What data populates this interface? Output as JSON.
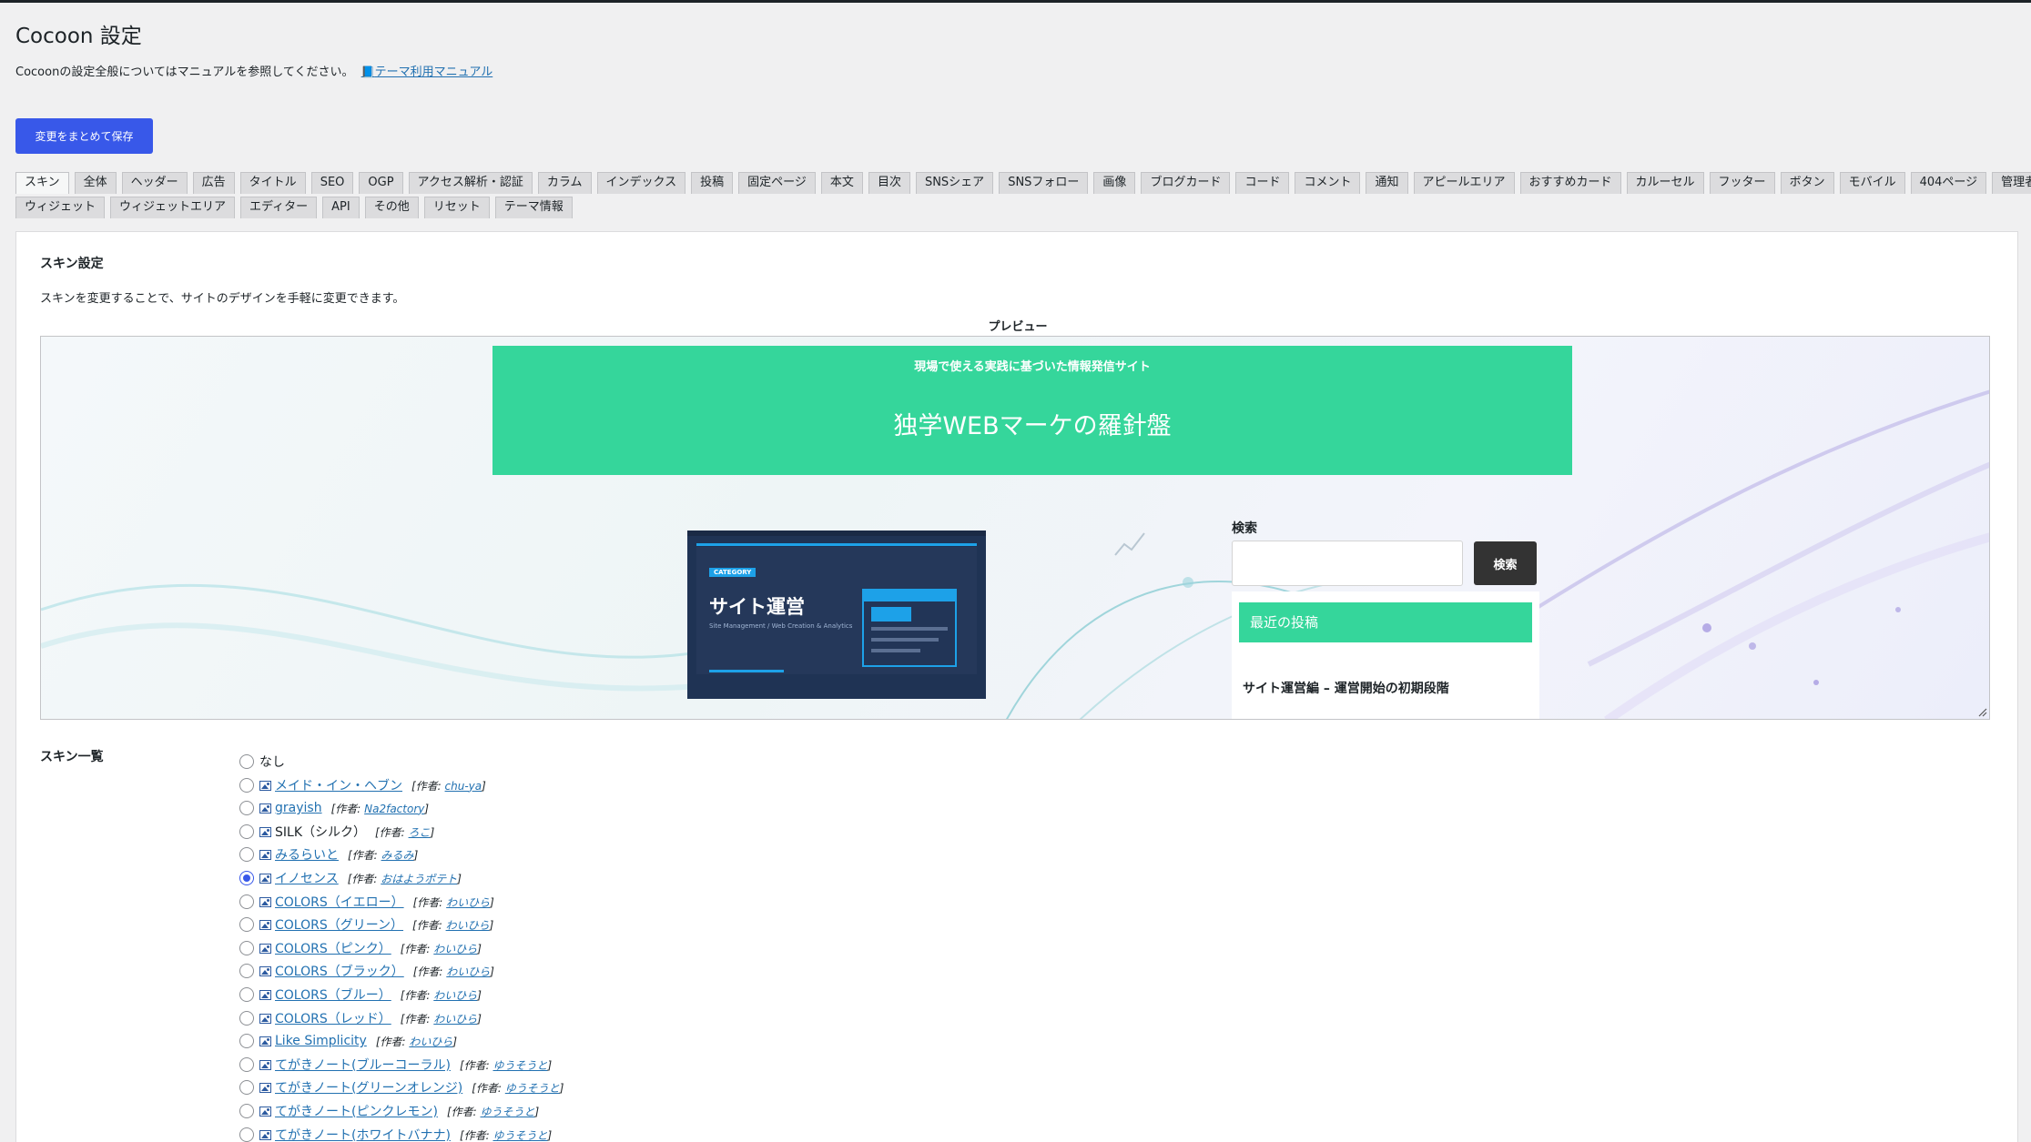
{
  "page": {
    "title": "Cocoon 設定",
    "intro": "Cocoonの設定全般についてはマニュアルを参照してください。",
    "manual_link": "テーマ利用マニュアル",
    "save_label": "変更をまとめて保存",
    "accent": "#3858e9"
  },
  "tabs_row1": [
    "スキン",
    "全体",
    "ヘッダー",
    "広告",
    "タイトル",
    "SEO",
    "OGP",
    "アクセス解析・認証",
    "カラム",
    "インデックス",
    "投稿",
    "固定ページ",
    "本文",
    "目次",
    "SNSシェア",
    "SNSフォロー",
    "画像",
    "ブログカード",
    "コード",
    "コメント",
    "通知",
    "アピールエリア",
    "おすすめカード",
    "カルーセル",
    "フッター",
    "ボタン",
    "モバイル",
    "404ページ",
    "管理者画面"
  ],
  "tabs_row2": [
    "ウィジェット",
    "ウィジェットエリア",
    "エディター",
    "API",
    "その他",
    "リセット",
    "テーマ情報"
  ],
  "skin": {
    "section_title": "スキン設定",
    "description": "スキンを変更することで、サイトのデザインを手軽に変更できます。",
    "preview_label": "プレビュー",
    "list_title": "スキン一覧"
  },
  "preview": {
    "tagline": "現場で使える実践に基づいた情報発信サイト",
    "site_name": "独学WEBマーケの羅針盤",
    "header_color": "#35d69b",
    "thumb_category": "CATEGORY",
    "thumb_title": "サイト運営",
    "thumb_subtitle": "Site Management / Web Creation & Analytics",
    "search_label": "検索",
    "search_button": "検索",
    "widget_title": "最近の投稿",
    "widget_item": "サイト運営編 – 運営開始の初期段階"
  },
  "skins": [
    {
      "name": "なし",
      "author": "",
      "checked": false,
      "link": false,
      "icon": false
    },
    {
      "name": "メイド・イン・ヘブン",
      "author": "chu-ya",
      "checked": false,
      "link": true,
      "icon": true
    },
    {
      "name": "grayish",
      "author": "Na2factory",
      "checked": false,
      "link": true,
      "icon": true
    },
    {
      "name": "SILK（シルク）",
      "author": "ろこ",
      "checked": false,
      "link": false,
      "icon": true
    },
    {
      "name": "みるらいと",
      "author": "みるみ",
      "checked": false,
      "link": true,
      "icon": true
    },
    {
      "name": "イノセンス",
      "author": "おはようポテト",
      "checked": true,
      "link": true,
      "icon": true
    },
    {
      "name": "COLORS（イエロー）",
      "author": "わいひら",
      "checked": false,
      "link": true,
      "icon": true
    },
    {
      "name": "COLORS（グリーン）",
      "author": "わいひら",
      "checked": false,
      "link": true,
      "icon": true
    },
    {
      "name": "COLORS（ピンク）",
      "author": "わいひら",
      "checked": false,
      "link": true,
      "icon": true
    },
    {
      "name": "COLORS（ブラック）",
      "author": "わいひら",
      "checked": false,
      "link": true,
      "icon": true
    },
    {
      "name": "COLORS（ブルー）",
      "author": "わいひら",
      "checked": false,
      "link": true,
      "icon": true
    },
    {
      "name": "COLORS（レッド）",
      "author": "わいひら",
      "checked": false,
      "link": true,
      "icon": true
    },
    {
      "name": "Like Simplicity",
      "author": "わいひら",
      "checked": false,
      "link": true,
      "icon": true
    },
    {
      "name": "てがきノート(ブルーコーラル)",
      "author": "ゆうそうと",
      "checked": false,
      "link": true,
      "icon": true
    },
    {
      "name": "てがきノート(グリーンオレンジ)",
      "author": "ゆうそうと",
      "checked": false,
      "link": true,
      "icon": true
    },
    {
      "name": "てがきノート(ピンクレモン)",
      "author": "ゆうそうと",
      "checked": false,
      "link": true,
      "icon": true
    },
    {
      "name": "てがきノート(ホワイトバナナ)",
      "author": "ゆうそうと",
      "checked": false,
      "link": true,
      "icon": true
    }
  ],
  "author_prefix": "[作者: ",
  "author_suffix": "]"
}
